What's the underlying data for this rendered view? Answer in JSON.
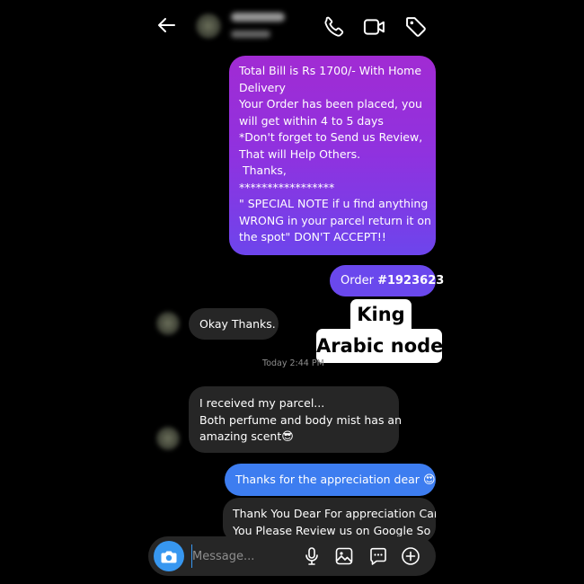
{
  "header": {
    "contact_name": "",
    "status": ""
  },
  "messages": {
    "order_bill": [
      "Total Bill is Rs 1700/-  With  Home",
      "Delivery",
      "Your Order has been placed,  you",
      "will get within 4 to 5 days",
      "*Don't forget to Send us Review,",
      "That will Help Others.",
      " Thanks,",
      "*****************",
      "\" SPECIAL NOTE if u find anything",
      "WRONG in your parcel return it on",
      "the spot\" DON'T ACCEPT!!"
    ],
    "order_id_prefix": "Order ",
    "order_id_number": "#1923623",
    "okay_thanks": "Okay Thanks.",
    "timestamp": "Today 2:44 PM",
    "parcel": [
      "I received my parcel...",
      "Both perfume and body mist has an",
      "amazing scent"
    ],
    "parcel_emoji": "😎",
    "thanks_appreciation": "Thanks for the appreciation dear",
    "thanks_emoji": "😍",
    "review_request": [
      "Thank You Dear For appreciation Can",
      "You Please Review us on Google So"
    ]
  },
  "watermark": {
    "line1": "King",
    "line2": "Arabic node"
  },
  "composer": {
    "placeholder": "Message..."
  },
  "colors": {
    "sent_gradient_top": "#a12bd3",
    "sent_gradient_bottom": "#6d45ec",
    "order_id_bubble": "#6a48ed",
    "thanks_bubble": "#3d7df0",
    "received_bubble": "#262626",
    "camera_button": "#3797f0"
  },
  "icons": {
    "back": "back-arrow-icon",
    "call": "phone-icon",
    "video": "video-camera-icon",
    "tag": "tag-icon",
    "camera": "camera-icon",
    "mic": "microphone-icon",
    "gallery": "image-icon",
    "sticker": "sticker-icon",
    "more": "plus-circle-icon"
  }
}
